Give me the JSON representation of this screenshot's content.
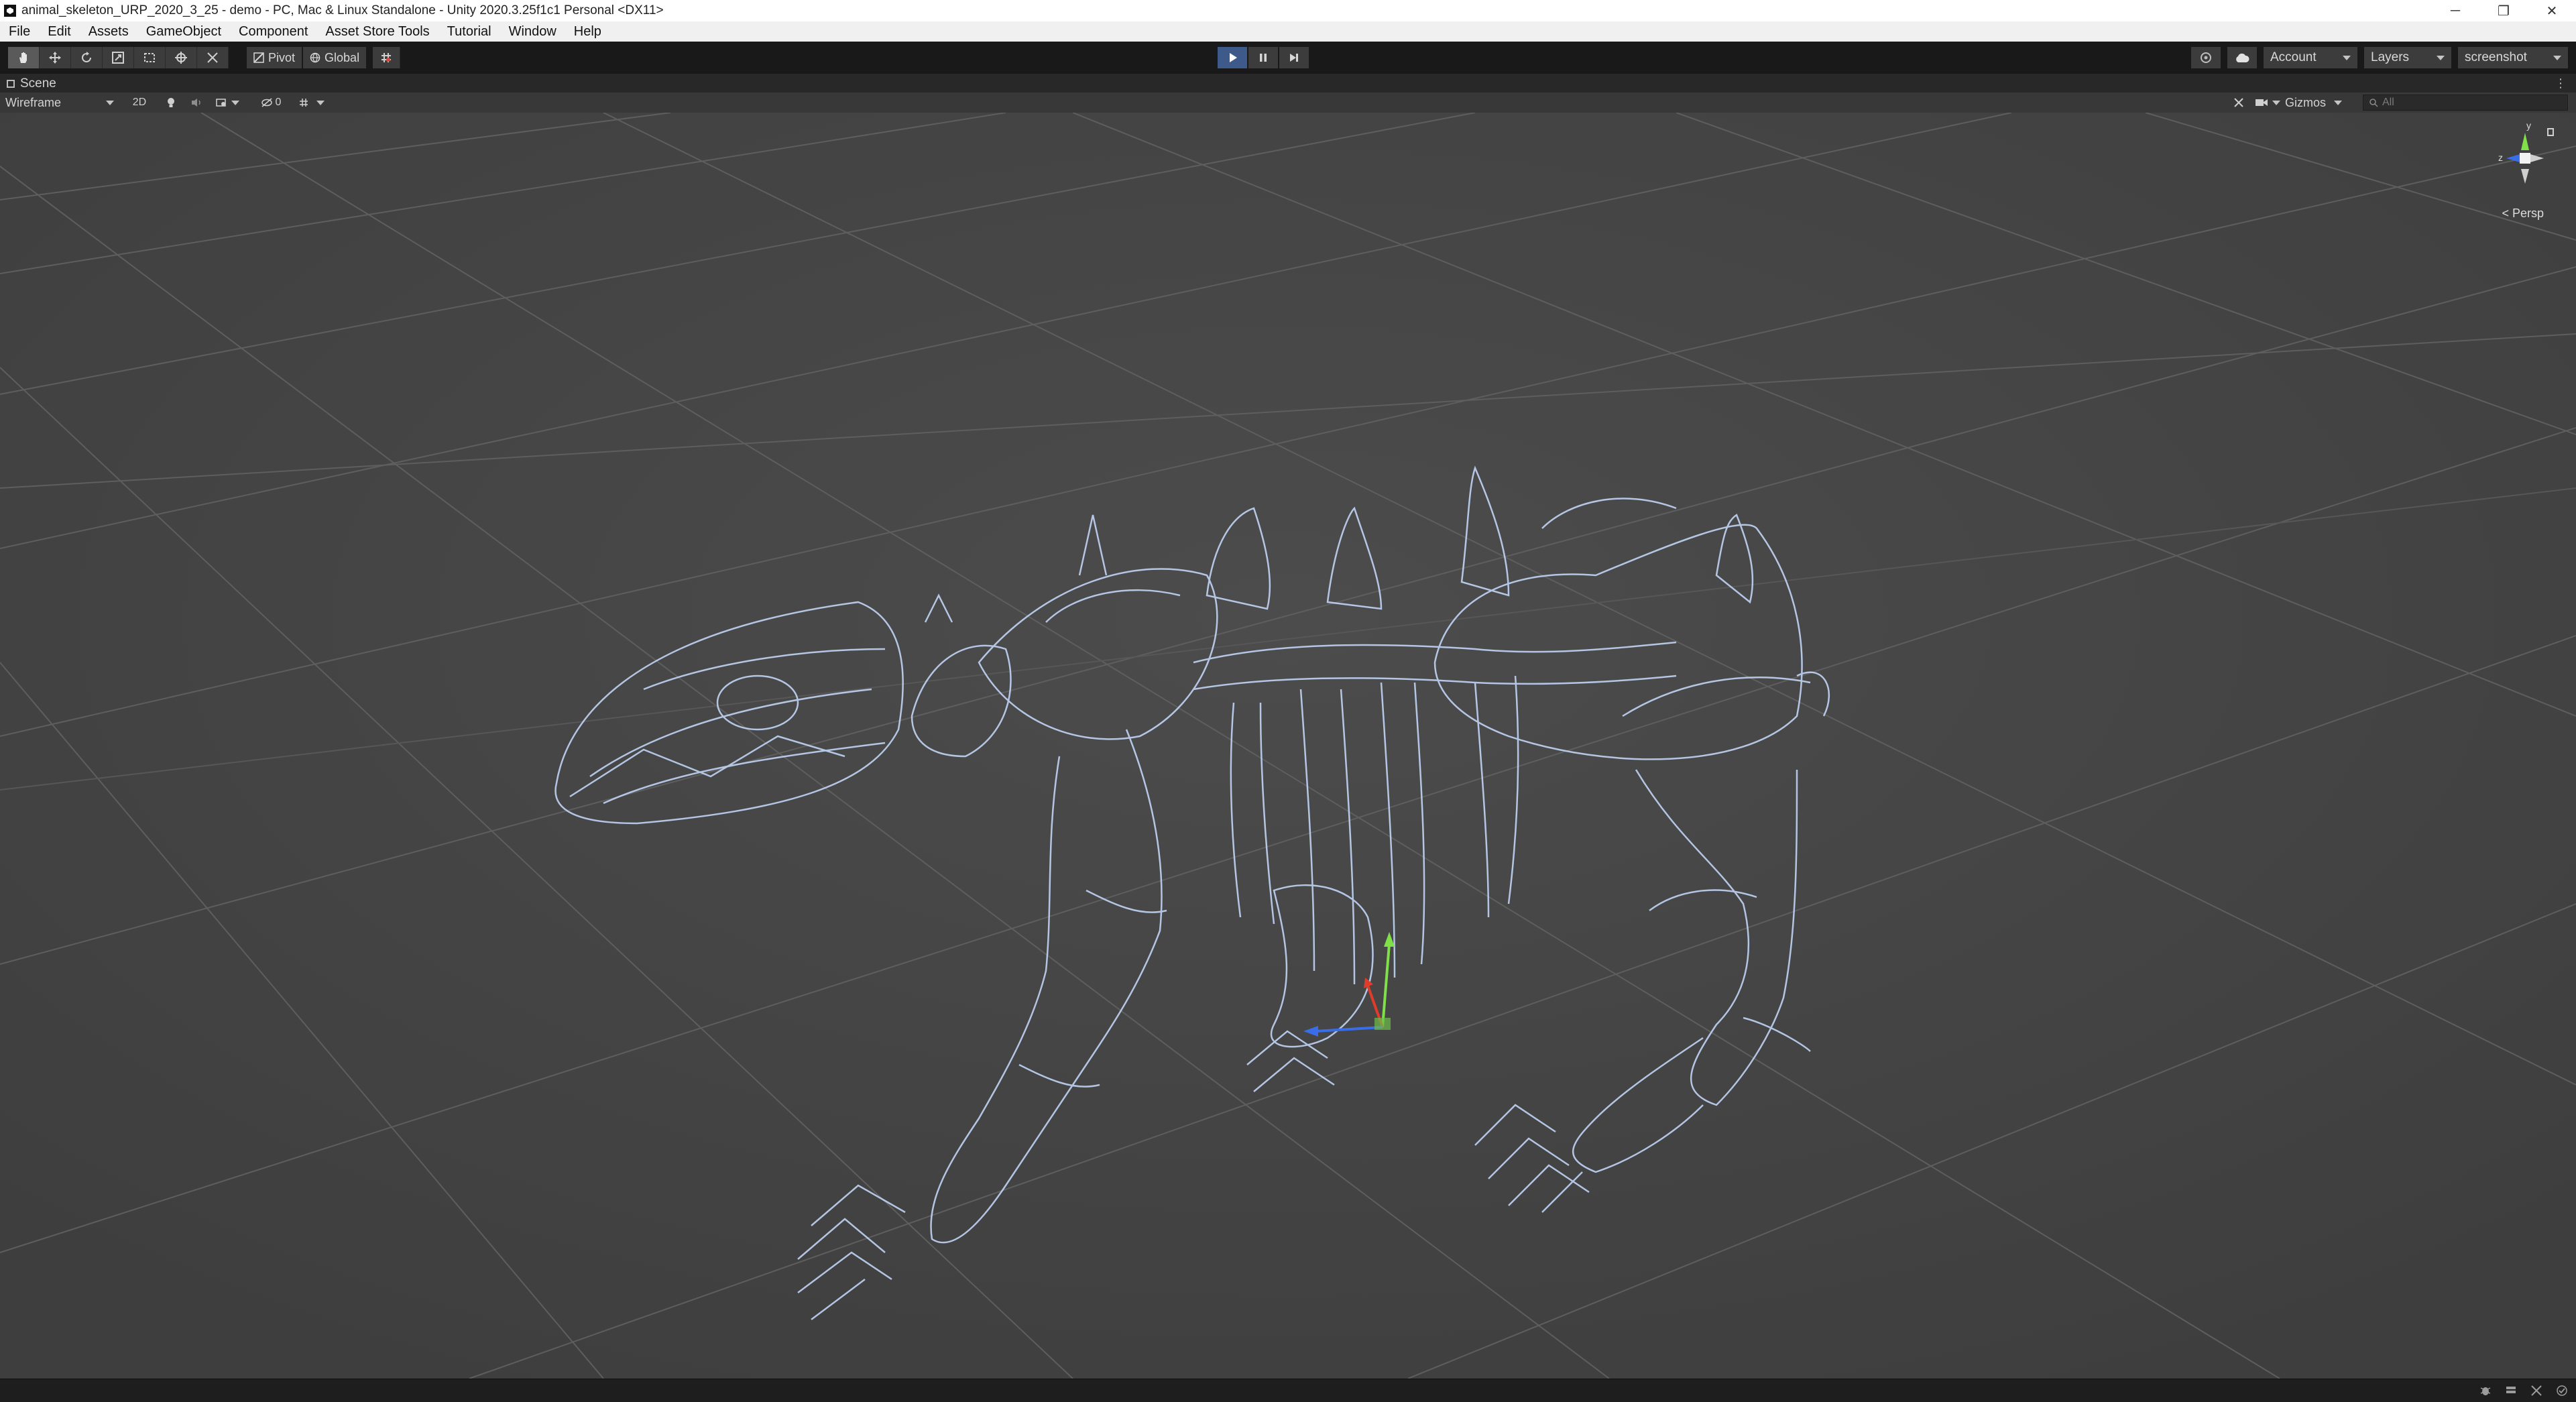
{
  "window": {
    "title": "animal_skeleton_URP_2020_3_25 - demo - PC, Mac & Linux Standalone - Unity 2020.3.25f1c1 Personal <DX11>",
    "controls": {
      "minimize": "─",
      "restore": "❐",
      "close": "✕"
    }
  },
  "menu": {
    "items": [
      "File",
      "Edit",
      "Assets",
      "GameObject",
      "Component",
      "Asset Store Tools",
      "Tutorial",
      "Window",
      "Help"
    ]
  },
  "toolbar": {
    "tools": [
      "hand-tool-icon",
      "move-tool-icon",
      "rotate-tool-icon",
      "scale-tool-icon",
      "rect-tool-icon",
      "transform-tool-icon",
      "custom-tool-icon"
    ],
    "active_tool": "hand-tool-icon",
    "pivot_label": "Pivot",
    "global_label": "Global",
    "play": {
      "state": "playing",
      "accent": "#3d5a8a"
    },
    "account_label": "Account",
    "layers_label": "Layers",
    "layout_label": "screenshot"
  },
  "scene": {
    "tab_label": "Scene",
    "draw_mode": "Wireframe",
    "mode_2d_label": "2D",
    "hidden_count": "0",
    "gizmos_label": "Gizmos",
    "search_placeholder": "All",
    "view_label": "< Persp",
    "axis_labels": {
      "y": "y",
      "z": "z"
    },
    "colors": {
      "background": "#474747",
      "grid": "#5c5c5c",
      "wireframe": "#c8dcff",
      "axis_x": "#e03c2c",
      "axis_y": "#7fe04a",
      "axis_z": "#3a6ee8"
    }
  }
}
